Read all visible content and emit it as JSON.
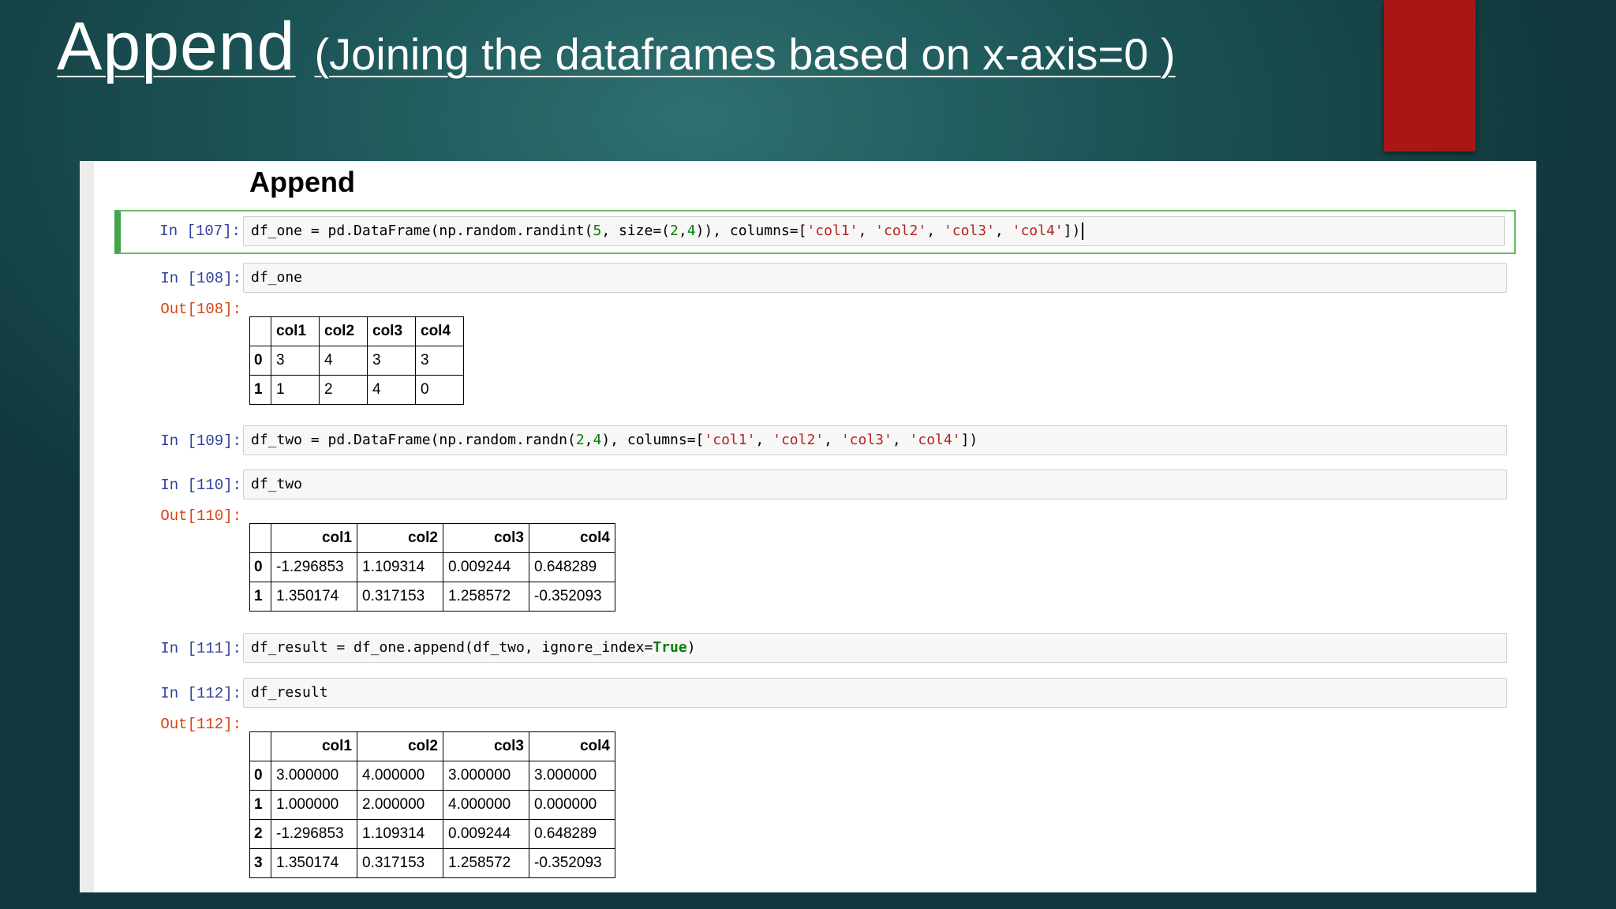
{
  "slide": {
    "title_main": "Append",
    "title_sub": "(Joining the dataframes based on x-axis=0 )"
  },
  "notebook": {
    "heading": "Append",
    "cells": [
      {
        "prompt": "In [107]:",
        "code": "df_one = pd.DataFrame(np.random.randint(5, size=(2,4)), columns=['col1', 'col2', 'col3', 'col4'])"
      },
      {
        "prompt": "In [108]:",
        "code": "df_one",
        "out_prompt": "Out[108]:"
      },
      {
        "prompt": "In [109]:",
        "code": "df_two = pd.DataFrame(np.random.randn(2,4), columns=['col1', 'col2', 'col3', 'col4'])"
      },
      {
        "prompt": "In [110]:",
        "code": "df_two",
        "out_prompt": "Out[110]:"
      },
      {
        "prompt": "In [111]:",
        "code": "df_result = df_one.append(df_two, ignore_index=True)"
      },
      {
        "prompt": "In [112]:",
        "code": "df_result",
        "out_prompt": "Out[112]:"
      }
    ],
    "tables": {
      "df_one": {
        "columns": [
          "col1",
          "col2",
          "col3",
          "col4"
        ],
        "index": [
          "0",
          "1"
        ],
        "rows": [
          [
            "3",
            "4",
            "3",
            "3"
          ],
          [
            "1",
            "2",
            "4",
            "0"
          ]
        ]
      },
      "df_two": {
        "columns": [
          "col1",
          "col2",
          "col3",
          "col4"
        ],
        "index": [
          "0",
          "1"
        ],
        "rows": [
          [
            "-1.296853",
            "1.109314",
            "0.009244",
            "0.648289"
          ],
          [
            "1.350174",
            "0.317153",
            "1.258572",
            "-0.352093"
          ]
        ]
      },
      "df_result": {
        "columns": [
          "col1",
          "col2",
          "col3",
          "col4"
        ],
        "index": [
          "0",
          "1",
          "2",
          "3"
        ],
        "rows": [
          [
            "3.000000",
            "4.000000",
            "3.000000",
            "3.000000"
          ],
          [
            "1.000000",
            "2.000000",
            "4.000000",
            "0.000000"
          ],
          [
            "-1.296853",
            "1.109314",
            "0.009244",
            "0.648289"
          ],
          [
            "1.350174",
            "0.317153",
            "1.258572",
            "-0.352093"
          ]
        ]
      }
    }
  },
  "colors": {
    "background": "#1d5658",
    "accent_red": "#a91616",
    "selected_cell": "#42a547",
    "in_prompt": "#303f9f",
    "out_prompt": "#d84315"
  }
}
